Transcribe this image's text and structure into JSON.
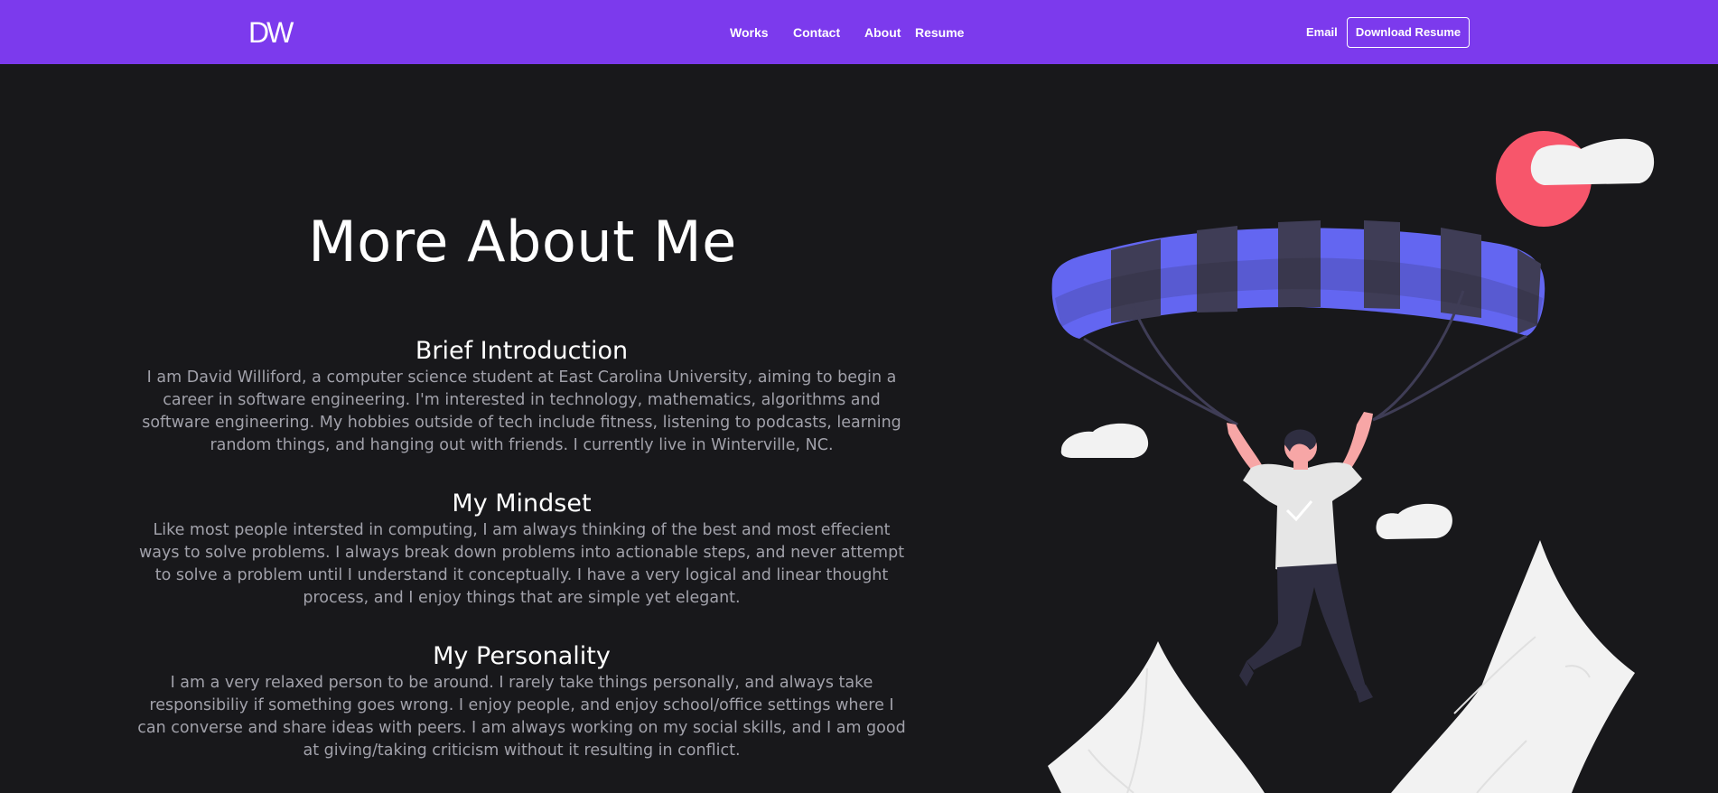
{
  "nav": {
    "logo": "DW",
    "links": [
      "Works",
      "Contact",
      "About",
      "Resume"
    ],
    "email": "Email",
    "download_resume": "Download Resume"
  },
  "colors": {
    "navbar": "#7c3aed",
    "background": "#18181b",
    "heading": "#ffffff",
    "body_text": "#a1a1aa",
    "accent_stripe": "#6366f1",
    "sun": "#f7566b"
  },
  "main": {
    "title": "More About Me",
    "sections": [
      {
        "heading": "Brief Introduction",
        "lines": [
          "I am David Williford, a computer science student at East Carolina University, aiming to begin a",
          "career in software engineering. I'm interested in technology, mathematics, algorithms and",
          "software engineering. My hobbies outside of tech include fitness, listening to podcasts, learning",
          "random things, and hanging out with friends. I currently live in Winterville, NC."
        ]
      },
      {
        "heading": "My Mindset",
        "lines": [
          "Like most people intersted in computing, I am always thinking of the best and most effecient",
          "ways to solve problems. I always break down problems into actionable steps, and never attempt",
          "to solve a problem until I understand it conceptually. I have a very logical and linear thought",
          "process, and I enjoy things that are simple yet elegant."
        ]
      },
      {
        "heading": "My Personality",
        "lines": [
          "I am a very relaxed person to be around. I rarely take things personally, and always take",
          "responsibiliy if something goes wrong. I enjoy people, and enjoy school/office settings where I",
          "can converse and share ideas with peers. I am always working on my social skills, and I am good",
          "at giving/taking criticism without it resulting in conflict."
        ]
      }
    ]
  },
  "illustration": {
    "icon": "paraglider-person-illustration"
  }
}
